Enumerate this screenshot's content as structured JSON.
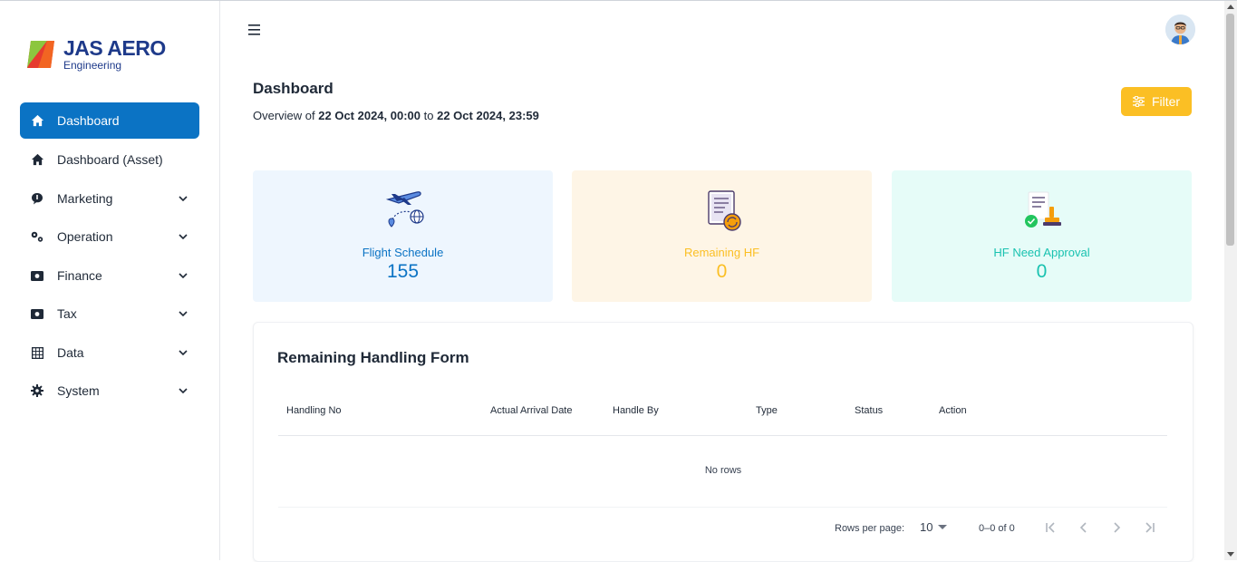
{
  "brand": {
    "name": "JAS AERO",
    "subtitle": "Engineering"
  },
  "sidebar": {
    "items": [
      {
        "label": "Dashboard",
        "icon": "home-icon",
        "active": true
      },
      {
        "label": "Dashboard (Asset)",
        "icon": "home-icon"
      },
      {
        "label": "Marketing",
        "icon": "chat-icon",
        "expandable": true
      },
      {
        "label": "Operation",
        "icon": "gears-icon",
        "expandable": true
      },
      {
        "label": "Finance",
        "icon": "money-icon",
        "expandable": true
      },
      {
        "label": "Tax",
        "icon": "money-icon",
        "expandable": true
      },
      {
        "label": "Data",
        "icon": "table-icon",
        "expandable": true
      },
      {
        "label": "System",
        "icon": "gear-icon",
        "expandable": true
      }
    ]
  },
  "header": {
    "menu_icon": "hamburger-icon",
    "avatar": "user-avatar"
  },
  "page": {
    "title": "Dashboard",
    "overview_prefix": "Overview of",
    "date_from": "22 Oct 2024, 00:00",
    "date_sep": "to",
    "date_to": "22 Oct 2024, 23:59",
    "filter_label": "Filter"
  },
  "cards": [
    {
      "label": "Flight Schedule",
      "value": "155",
      "color": "#0b73c4",
      "bg": "#eef6fe"
    },
    {
      "label": "Remaining HF",
      "value": "0",
      "color": "#fbbf24",
      "bg": "#fef5e6"
    },
    {
      "label": "HF Need Approval",
      "value": "0",
      "color": "#19c2b0",
      "bg": "#e6fcf8"
    }
  ],
  "table": {
    "title": "Remaining Handling Form",
    "columns": [
      "Handling No",
      "Actual Arrival Date",
      "Handle By",
      "Type",
      "Status",
      "Action"
    ],
    "rows": [],
    "empty_text": "No rows",
    "rows_per_page_label": "Rows per page:",
    "rows_per_page": "10",
    "range": "0–0 of 0"
  },
  "colors": {
    "primary": "#0b73c4",
    "accent": "#fbbf24"
  }
}
